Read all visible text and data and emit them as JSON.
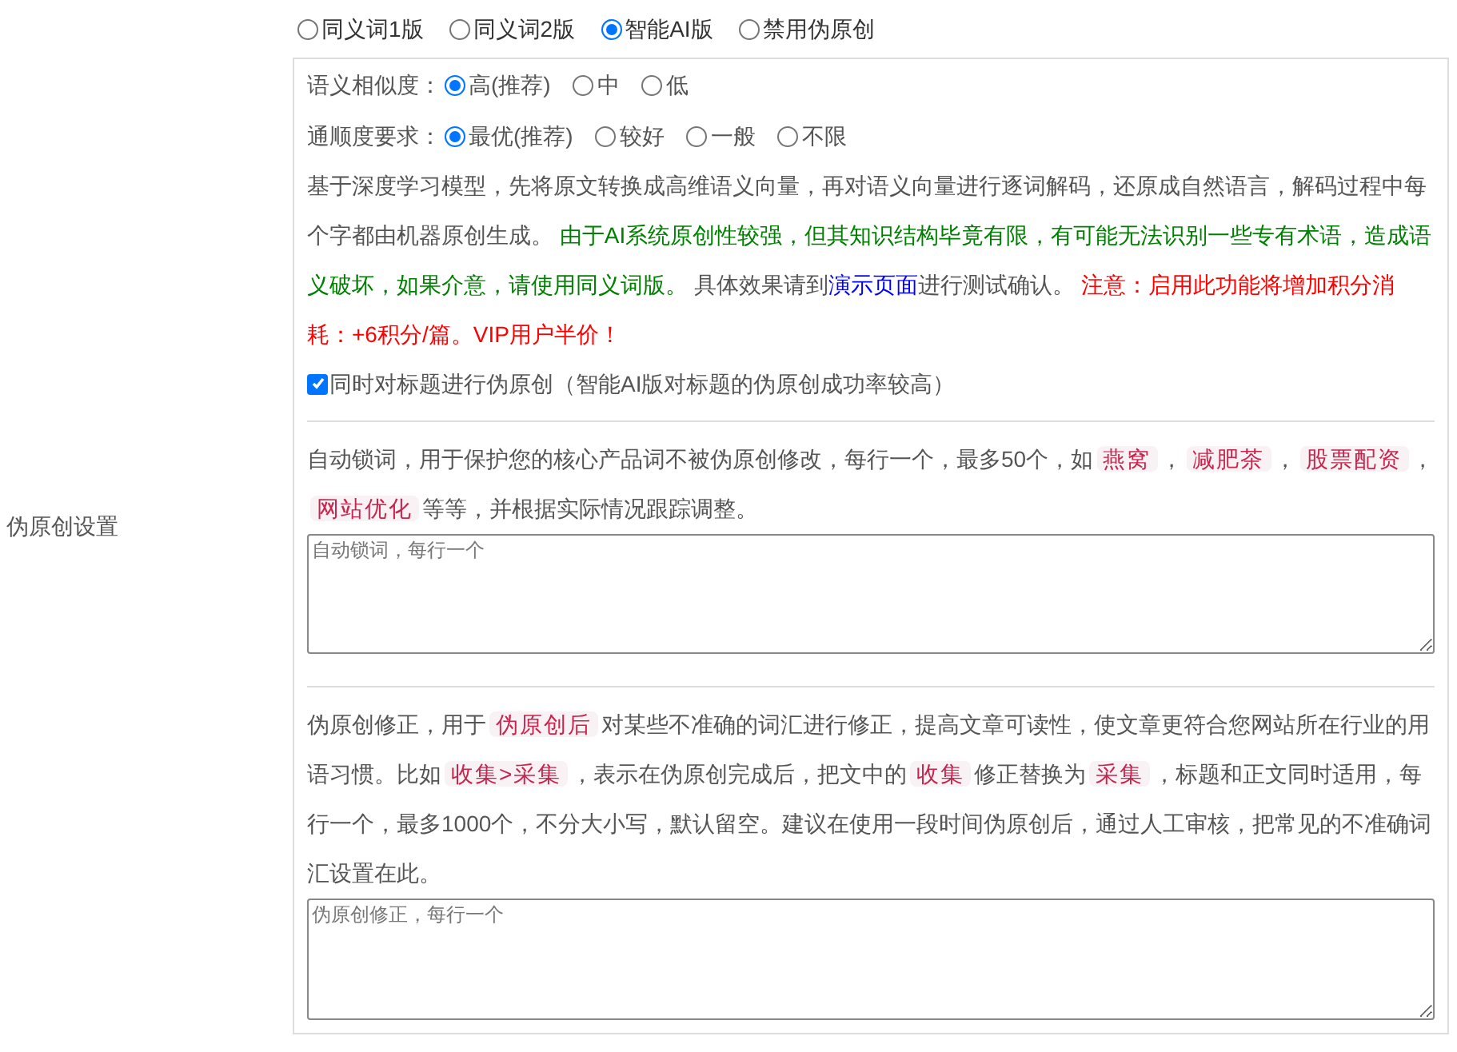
{
  "section_label": "伪原创设置",
  "modes": [
    {
      "label": "同义词1版",
      "selected": false
    },
    {
      "label": "同义词2版",
      "selected": false
    },
    {
      "label": "智能AI版",
      "selected": true
    },
    {
      "label": "禁用伪原创",
      "selected": false
    }
  ],
  "option_groups": [
    {
      "label": "语义相似度：",
      "options": [
        {
          "label": "高(推荐)",
          "selected": true
        },
        {
          "label": "中",
          "selected": false
        },
        {
          "label": "低",
          "selected": false
        }
      ]
    },
    {
      "label": "通顺度要求：",
      "options": [
        {
          "label": "最优(推荐)",
          "selected": true
        },
        {
          "label": "较好",
          "selected": false
        },
        {
          "label": "一般",
          "selected": false
        },
        {
          "label": "不限",
          "selected": false
        }
      ]
    }
  ],
  "ai_description": [
    {
      "kind": "text",
      "text": "基于深度学习模型，先将原文转换成高维语义向量，再对语义向量进行逐词解码，还原成自然语言，解码过程中每个字都由机器原创生成。 "
    },
    {
      "kind": "green",
      "text": "由于AI系统原创性较强，但其知识结构毕竟有限，有可能无法识别一些专有术语，造成语义破坏，如果介意，请使用同义词版。"
    },
    {
      "kind": "text",
      "text": " 具体效果请到"
    },
    {
      "kind": "link",
      "text": "演示页面"
    },
    {
      "kind": "text",
      "text": "进行测试确认。 "
    },
    {
      "kind": "red",
      "text": "注意：启用此功能将增加积分消耗：+6积分/篇。VIP用户半价！"
    }
  ],
  "title_option": {
    "label": "同时对标题进行伪原创（智能AI版对标题的伪原创成功率较高）",
    "checked": true
  },
  "lock_words": {
    "description": [
      {
        "kind": "text",
        "text": "自动锁词，用于保护您的核心产品词不被伪原创修改，每行一个，最多50个，如"
      },
      {
        "kind": "code",
        "text": "燕窝"
      },
      {
        "kind": "text",
        "text": "，"
      },
      {
        "kind": "code",
        "text": "减肥茶"
      },
      {
        "kind": "text",
        "text": "，"
      },
      {
        "kind": "code",
        "text": "股票配资"
      },
      {
        "kind": "text",
        "text": "，"
      },
      {
        "kind": "code",
        "text": "网站优化"
      },
      {
        "kind": "text",
        "text": "等等，并根据实际情况跟踪调整。"
      }
    ],
    "placeholder": "自动锁词，每行一个"
  },
  "corrections": {
    "description": [
      {
        "kind": "text",
        "text": "伪原创修正，用于"
      },
      {
        "kind": "code",
        "text": "伪原创后"
      },
      {
        "kind": "text",
        "text": "对某些不准确的词汇进行修正，提高文章可读性，使文章更符合您网站所在行业的用语习惯。比如"
      },
      {
        "kind": "code",
        "text": "收集>采集"
      },
      {
        "kind": "text",
        "text": "，表示在伪原创完成后，把文中的"
      },
      {
        "kind": "code",
        "text": "收集"
      },
      {
        "kind": "text",
        "text": "修正替换为"
      },
      {
        "kind": "code",
        "text": "采集"
      },
      {
        "kind": "text",
        "text": "，标题和正文同时适用，每行一个，最多1000个，不分大小写，默认留空。建议在使用一段时间伪原创后，通过人工审核，把常见的不准确词汇设置在此。"
      }
    ],
    "placeholder": "伪原创修正，每行一个"
  }
}
